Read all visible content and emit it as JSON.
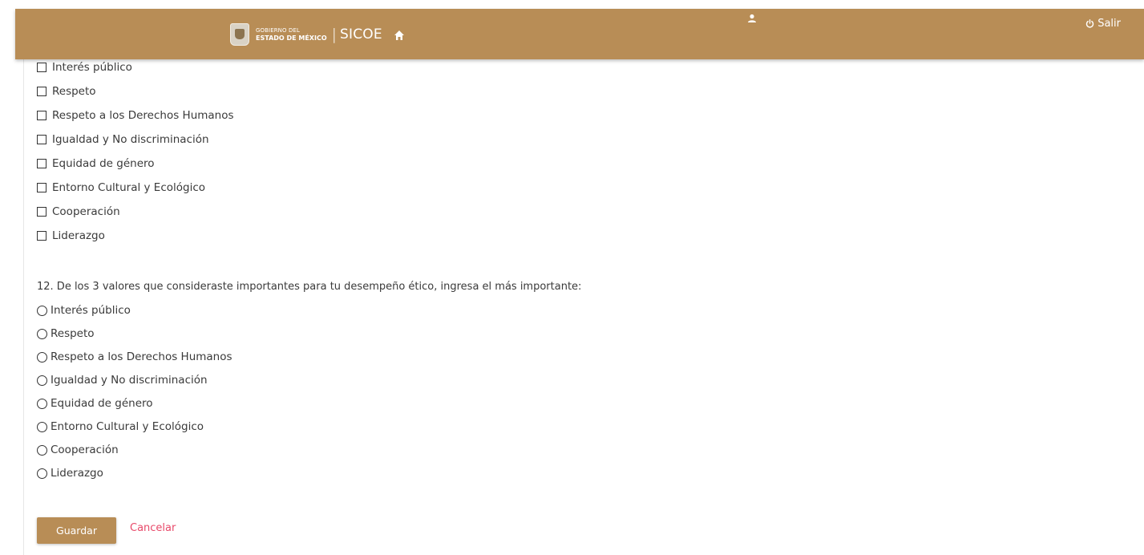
{
  "header": {
    "logo_line1": "GOBIERNO DEL",
    "logo_line2": "ESTADO DE MÉXICO",
    "separator": "|",
    "app_name": "SICOE",
    "logout_label": "Salir",
    "icons": [
      "home-icon",
      "user-icon",
      "power-icon"
    ],
    "bar_color": "#b88d56"
  },
  "question11": {
    "options": [
      "Interés público",
      "Respeto",
      "Respeto a los Derechos Humanos",
      "Igualdad y No discriminación",
      "Equidad de género",
      "Entorno Cultural y Ecológico",
      "Cooperación",
      "Liderazgo"
    ]
  },
  "question12": {
    "text": "12. De los 3 valores que consideraste importantes para tu desempeño ético, ingresa el más importante:",
    "options": [
      "Interés público",
      "Respeto",
      "Respeto a los Derechos Humanos",
      "Igualdad y No discriminación",
      "Equidad de género",
      "Entorno Cultural y Ecológico",
      "Cooperación",
      "Liderazgo"
    ]
  },
  "actions": {
    "save_label": "Guardar",
    "cancel_label": "Cancelar",
    "accent_color": "#b88d56",
    "cancel_color": "#e84a6a"
  }
}
